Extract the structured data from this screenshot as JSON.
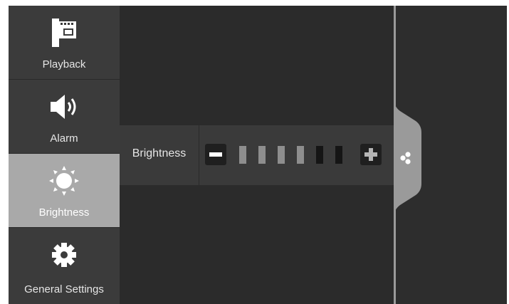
{
  "sidebar": {
    "items": [
      {
        "label": "Playback",
        "icon": "film-icon"
      },
      {
        "label": "Alarm",
        "icon": "speaker-icon"
      },
      {
        "label": "Brightness",
        "icon": "sun-icon",
        "active": true
      },
      {
        "label": "General Settings",
        "icon": "gear-icon"
      }
    ]
  },
  "brightness": {
    "label": "Brightness",
    "level": 4,
    "max": 6,
    "decrease_icon": "minus-icon",
    "increase_icon": "plus-icon"
  },
  "panel_tab": {
    "icon": "dots-icon"
  },
  "colors": {
    "background": "#2f2f2f",
    "active_item": "#a9a9a9",
    "segment_on": "#8e8e8e",
    "segment_off": "#151515"
  }
}
